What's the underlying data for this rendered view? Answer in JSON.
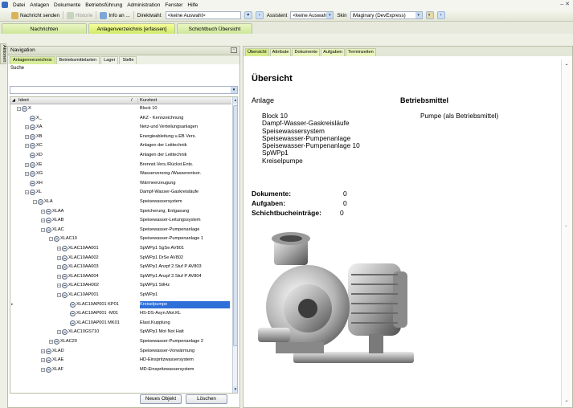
{
  "menu": {
    "items": [
      "Datei",
      "Anlagen",
      "Dokumente",
      "Betriebsführung",
      "Administration",
      "Fenster",
      "Hilfe"
    ]
  },
  "toolbar": {
    "nachricht_senden": "Nachricht senden",
    "historie": "Historie",
    "info_an": "Info an ...",
    "direktwahl_label": "Direktwahl:",
    "direktwahl_value": "<keine Auswahl>",
    "assistent_label": "Assistent",
    "assistent_value": "<keine Auswahl>",
    "skin_label": "Skin",
    "skin_value": "iMaginary (DevExpress)"
  },
  "nav_tabs": [
    "Nachrichten",
    "Anlagenverzeichnis [erfassen]",
    "Schichtbuch Übersicht"
  ],
  "left_strip": "Aktionen",
  "navigation": {
    "title": "Navigation",
    "subtabs": [
      "Anlagenverzeichnis",
      "Betriebsmittelarten",
      "Lager",
      "Stelle"
    ],
    "search_label": "Suche",
    "columns": {
      "ident": "Ident",
      "kurztext": "Kurztext"
    },
    "rows": [
      {
        "ident": "X",
        "kurztext": "Block 10"
      },
      {
        "ident": "X_",
        "kurztext": "AKZ - Kennzeichnung"
      },
      {
        "ident": "XA",
        "kurztext": "Netz-und Verteilungsanlagen"
      },
      {
        "ident": "XB",
        "kurztext": "Energieableitung u.EB Vers."
      },
      {
        "ident": "XC",
        "kurztext": "Anlagen der Leittechnik"
      },
      {
        "ident": "XD",
        "kurztext": "Anlagen der Leittechnik"
      },
      {
        "ident": "XE",
        "kurztext": "Brennst.Vers./Rückst.Ents."
      },
      {
        "ident": "XG",
        "kurztext": "Wasserversorg./Wasserentsor."
      },
      {
        "ident": "XH",
        "kurztext": "Wärmeerzeugung"
      },
      {
        "ident": "XL",
        "kurztext": "Dampf-Wasser-Gaskreisläufe"
      },
      {
        "ident": "XLA",
        "kurztext": "Speisewassersystem"
      },
      {
        "ident": "XLAA",
        "kurztext": "Speicherung, Entgasung"
      },
      {
        "ident": "XLAB",
        "kurztext": "Speisewasser-Leitungssystem"
      },
      {
        "ident": "XLAC",
        "kurztext": "Speisewasser-Pumpenanlage"
      },
      {
        "ident": "XLAC10",
        "kurztext": "Speisewasser-Pumpenanlage 1"
      },
      {
        "ident": "XLAC10AA001",
        "kurztext": "SpWPp1 SgSe AV801"
      },
      {
        "ident": "XLAC10AA002",
        "kurztext": "SpWPp1 DrSe AV802"
      },
      {
        "ident": "XLAC10AA003",
        "kurztext": "SpWPp1 Anzpf 2.Stuf P AV803"
      },
      {
        "ident": "XLAC10AA004",
        "kurztext": "SpWPp1 Anzpf 2.Stuf P AV804"
      },
      {
        "ident": "XLAC10AH002",
        "kurztext": "SpWPp1 StlHz"
      },
      {
        "ident": "XLAC10AP001",
        "kurztext": "SpWPp1"
      },
      {
        "ident": "XLAC10AP001 KP01",
        "kurztext": "Kreiselpumpe"
      },
      {
        "ident": "XLAC10AP001 -M01",
        "kurztext": "HS-DS-Asyn.Mot.KL"
      },
      {
        "ident": "XLAC10AP001 MK01",
        "kurztext": "Elast.Kupplung"
      },
      {
        "ident": "XLAC10GS710",
        "kurztext": "SpWPp1 Mot Not Halt"
      },
      {
        "ident": "XLAC20",
        "kurztext": "Speisewasser-Pumpenanlage 2"
      },
      {
        "ident": "XLAD",
        "kurztext": "Speisewasser-Vorwärmung"
      },
      {
        "ident": "XLAE",
        "kurztext": "HD-Einspritzwassersystem"
      },
      {
        "ident": "XLAF",
        "kurztext": "MD-Einspritzwassersystem"
      }
    ],
    "new_button": "Neues Objekt",
    "delete_button": "Löschen"
  },
  "detail": {
    "tabs": [
      "Übersicht",
      "Attribute",
      "Dokumente",
      "Aufgaben",
      "Terminzeiten"
    ],
    "title": "Übersicht",
    "anlage_heading": "Anlage",
    "anlage_items": [
      "Block 10",
      "Dampf-Wasser-Gaskreisläufe",
      "Speisewassersystem",
      "Speisewasser-Pumpenanlage",
      "Speisewasser-Pumpenanlage 10",
      "SpWPp1",
      "Kreiselpumpe"
    ],
    "betriebsmittel_heading": "Betriebsmittel",
    "betriebsmittel_value": "Pumpe (als Betriebsmittel)",
    "counts": [
      {
        "label": "Dokumente:",
        "value": "0"
      },
      {
        "label": "Aufgaben:",
        "value": "0"
      },
      {
        "label": "Schichtbucheinträge:",
        "value": "0"
      }
    ]
  }
}
